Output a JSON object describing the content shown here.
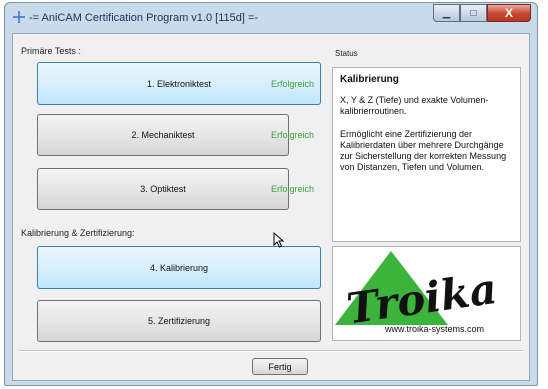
{
  "window": {
    "title": "-= AniCAM Certification Program v1.0 [115d] =-",
    "caption_buttons": {
      "minimize": "▁",
      "maximize": "□",
      "close": "X"
    }
  },
  "sections": {
    "primary_tests": "Primäre Tests :",
    "calibration": "Kalibrierung & Zertifizierung:",
    "status": "Status"
  },
  "tests": [
    {
      "label": "1. Elektroniktest",
      "result": "Erfolgreich"
    },
    {
      "label": "2. Mechaniktest",
      "result": "Erfolgreich"
    },
    {
      "label": "3. Optiktest",
      "result": "Erfolgreich"
    }
  ],
  "calibration_buttons": [
    {
      "label": "4. Kalibrierung"
    },
    {
      "label": "5. Zertifizierung"
    }
  ],
  "status_panel": {
    "heading": "Kalibrierung",
    "paragraph1": "X, Y & Z (Tiefe) und exakte Volumen-kalibrierroutinen.",
    "paragraph2": "Ermöglicht eine Zertifizierung der Kalibrierdaten über mehrere Durchgänge zur Sicherstellung der korrekten Messung von Distanzen, Tiefen und Volumen."
  },
  "logo": {
    "wordmark": "Troika",
    "url": "www.troika-systems.com"
  },
  "footer": {
    "done_label": "Fertig"
  },
  "colors": {
    "success": "#3aa13a",
    "highlight_button": "#d9f0fc",
    "logo_green": "#3cb43c"
  }
}
